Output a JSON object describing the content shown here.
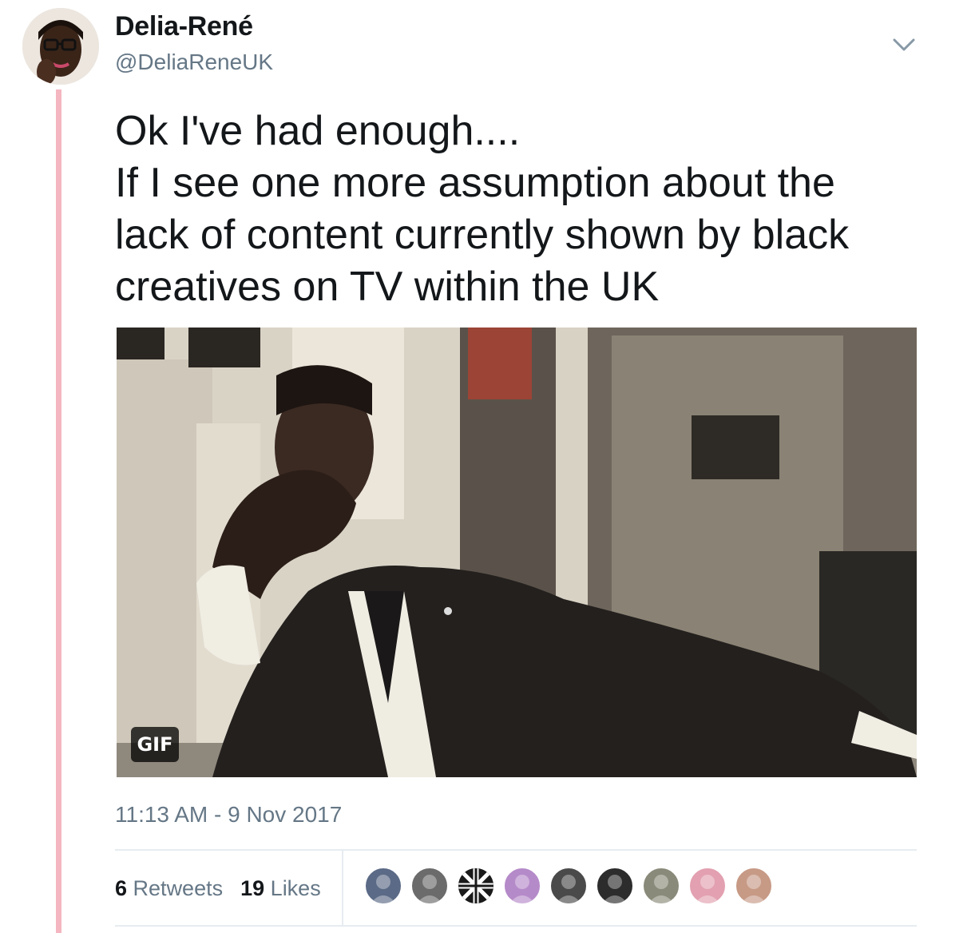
{
  "tweet": {
    "author_name": "Delia-René",
    "author_handle": "@DeliaReneUK",
    "text_lines": [
      "Ok I've had enough....",
      "If I see one more assumption about the",
      "lack of content currently shown by black",
      "creatives on TV within the UK"
    ],
    "media_badge": "GIF",
    "timestamp": "11:13 AM - 9 Nov 2017"
  },
  "stats": {
    "retweets_count": "6",
    "retweets_label": "Retweets",
    "likes_count": "19",
    "likes_label": "Likes"
  },
  "likers": [
    {
      "icon": "user-avatar",
      "color": "#5b6a86"
    },
    {
      "icon": "user-avatar",
      "color": "#6b6b6b"
    },
    {
      "icon": "union-jack-avatar",
      "color": "#1a1a1a"
    },
    {
      "icon": "user-avatar",
      "color": "#b58ac9"
    },
    {
      "icon": "user-avatar",
      "color": "#4a4a4a"
    },
    {
      "icon": "user-avatar",
      "color": "#2c2c2c"
    },
    {
      "icon": "user-avatar",
      "color": "#8a8a7a"
    },
    {
      "icon": "user-avatar",
      "color": "#e2a0b0"
    },
    {
      "icon": "user-avatar",
      "color": "#c79a86"
    }
  ],
  "colors": {
    "thread_line": "#f4b6c0",
    "secondary_text": "#657786",
    "primary_text": "#14171a"
  }
}
